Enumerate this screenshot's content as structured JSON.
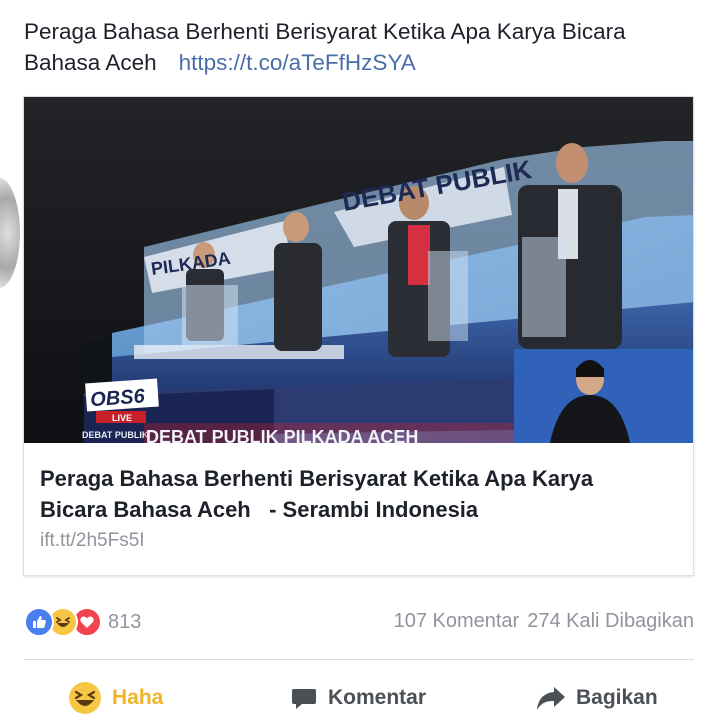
{
  "post": {
    "text": "Peraga Bahasa Berhenti Berisyarat Ketika Apa Karya Bicara Bahasa Aceh",
    "link": "https://t.co/aTeFfHzSYA"
  },
  "card": {
    "image_texts": {
      "banner_top": "DEBAT PUBLIK",
      "pilkada": "PILKADA",
      "channel_logo": "OBS6",
      "live": "LIVE",
      "debat_small": "DEBAT PUBLIK",
      "ticker": "DEBAT PUBLIK PILKADA ACEH"
    },
    "title_line1": "Peraga Bahasa Berhenti Berisyarat Ketika Apa Karya",
    "title_line2": "Bicara Bahasa Aceh",
    "title_source": "- Serambi Indonesia",
    "domain": "ift.tt/2h5Fs5I"
  },
  "stats": {
    "reaction_icons": [
      "like-icon",
      "haha-icon",
      "love-icon"
    ],
    "reaction_count": "813",
    "comments": "107 Komentar",
    "shares": "274 Kali Dibagikan"
  },
  "actions": {
    "react_label": "Haha",
    "comment_label": "Komentar",
    "share_label": "Bagikan"
  },
  "colors": {
    "link": "#4a6ea8",
    "haha": "#f0b428",
    "like": "#4a7ff0",
    "love": "#f0424f",
    "muted": "#90949c"
  }
}
